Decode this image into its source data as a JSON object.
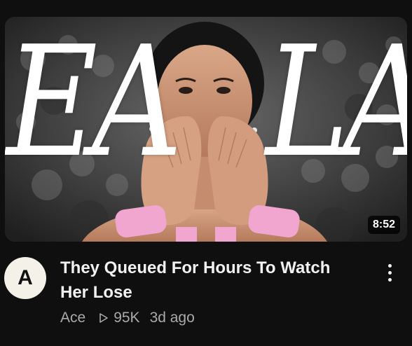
{
  "video": {
    "thumbnail": {
      "overlay_left": "EA",
      "overlay_right": "LA",
      "duration": "8:52",
      "subject": "woman blowing a kiss with both hands, pink wristbands, crowd background"
    },
    "channel": {
      "avatar_letter": "A",
      "name": "Ace"
    },
    "title": "They Queued For Hours To Watch Her Lose",
    "views": "95K",
    "age": "3d ago",
    "icons": {
      "views": "play-outline-icon",
      "menu": "more-vert-icon"
    }
  },
  "colors": {
    "background": "#0f0f0f",
    "title": "#f1f1f1",
    "meta": "#aaaaaa",
    "avatar_bg": "#f4f1e8",
    "wristband": "#f0a6cf"
  }
}
